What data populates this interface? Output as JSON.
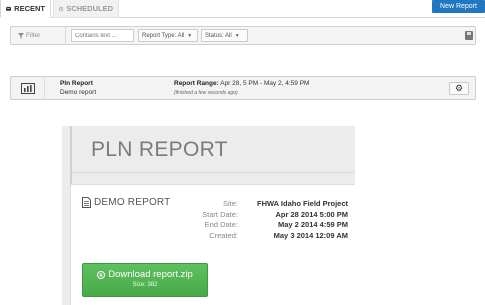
{
  "tabs": [
    {
      "label": "RECENT",
      "icon": "tray-icon",
      "active": true
    },
    {
      "label": "SCHEDULED",
      "icon": "clock-icon",
      "active": false
    }
  ],
  "new_report_label": "New Report",
  "filter": {
    "label": "Filter",
    "search_placeholder": "Contains text ...",
    "report_type": "Report Type: All",
    "status": "Status: All"
  },
  "report_row": {
    "name": "Pln Report",
    "description": "Demo report",
    "range_label": "Report Range:",
    "range_value": "Apr 28, 5 PM - May 2, 4:59 PM",
    "finished": "(finished a few seconds ago)"
  },
  "email": {
    "title": "PLN REPORT",
    "heading": "DEMO REPORT",
    "meta_labels": [
      "Site:",
      "Start Date:",
      "End Date:",
      "Created:"
    ],
    "meta_values": [
      "FHWA Idaho Field Project",
      "Apr 28 2014 5:00 PM",
      "May 2 2014 4:59 PM",
      "May 3 2014 12:09 AM"
    ],
    "download_label": "Download report.zip",
    "download_size": "Size: 382"
  },
  "colors": {
    "accent": "#1f78c1",
    "download_green": "#4cae4c"
  }
}
